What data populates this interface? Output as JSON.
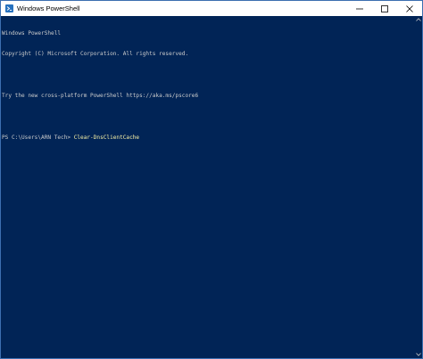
{
  "window": {
    "title": "Windows PowerShell",
    "icon": "powershell-icon"
  },
  "controls": {
    "minimize": "minimize-icon",
    "maximize": "maximize-icon",
    "close": "close-icon"
  },
  "console": {
    "lines": [
      "Windows PowerShell",
      "Copyright (C) Microsoft Corporation. All rights reserved.",
      "",
      "Try the new cross-platform PowerShell https://aka.ms/pscore6",
      ""
    ],
    "prompt": "PS C:\\Users\\ARN Tech> ",
    "command": "Clear-DnsClientCache"
  },
  "colors": {
    "background": "#012456",
    "text": "#cccccc",
    "command": "#f9f1a5"
  }
}
